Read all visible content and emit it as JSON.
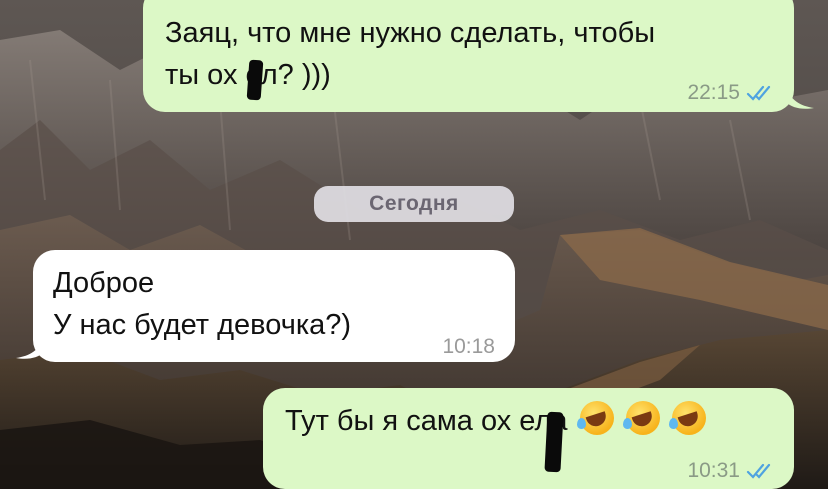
{
  "date_separator": "Сегодня",
  "messages": [
    {
      "direction": "outgoing",
      "text": "Заяц, что мне нужно сделать, чтобы\nты ох  ел? )))",
      "time": "22:15",
      "status": "read"
    },
    {
      "direction": "incoming",
      "text": "Доброе\nУ нас будет девочка?)",
      "time": "10:18"
    },
    {
      "direction": "outgoing",
      "text": "Тут бы я сама ох  ела",
      "emojis": [
        "rolling-on-floor-laughing-emoji",
        "rolling-on-floor-laughing-emoji",
        "rolling-on-floor-laughing-emoji"
      ],
      "time": "10:31",
      "status": "read"
    }
  ],
  "colors": {
    "outgoing_bubble": "#dcf8c6",
    "incoming_bubble": "#ffffff",
    "read_ticks": "#4fa3e0",
    "date_pill": "#e1dee4"
  }
}
